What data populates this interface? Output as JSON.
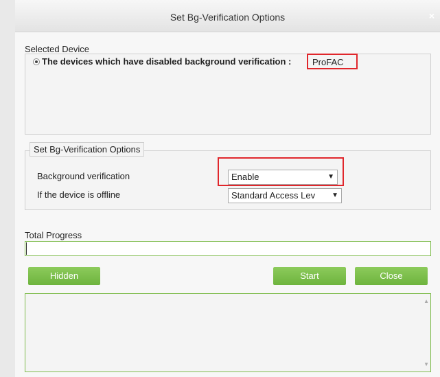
{
  "dialog": {
    "title": "Set Bg-Verification Options",
    "close_glyph": "×"
  },
  "selected_device": {
    "label": "Selected Device",
    "option_text": "The devices which have disabled background verification :",
    "device_name": "ProFAC"
  },
  "options": {
    "legend": "Set Bg-Verification Options",
    "background_verification": {
      "label": "Background verification",
      "value": "Enable",
      "arrow": "▼"
    },
    "offline": {
      "label": "If the device is offline",
      "value": "Standard Access Lev",
      "arrow": "▼"
    }
  },
  "progress": {
    "label": "Total Progress",
    "value": 0.0
  },
  "buttons": {
    "hidden": "Hidden",
    "start": "Start",
    "close": "Close"
  },
  "scroll": {
    "up": "▲",
    "down": "▼"
  },
  "colors": {
    "accent_green": "#7dbb4a",
    "highlight_red": "#e0262b"
  }
}
